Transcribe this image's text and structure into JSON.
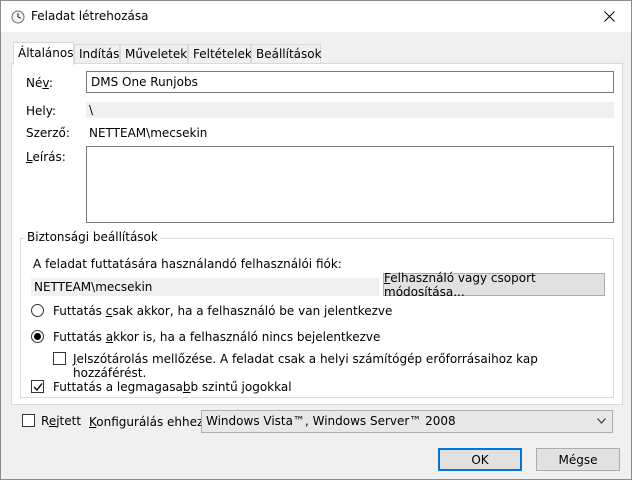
{
  "window": {
    "title": "Feladat létrehozása"
  },
  "tabs": [
    {
      "label": "Általános",
      "active": true
    },
    {
      "label": "Indítás"
    },
    {
      "label": "Műveletek"
    },
    {
      "label": "Feltételek"
    },
    {
      "label": "Beállítások"
    }
  ],
  "general": {
    "name_label": "Név:",
    "name_value": "DMS One Runjobs",
    "location_label": "Hely:",
    "location_value": "\\",
    "author_label": "Szerző:",
    "author_value": "NETTEAM\\mecsekin",
    "description_label": "Leírás:",
    "description_value": ""
  },
  "security": {
    "title": "Biztonsági beállítások",
    "account_label": "A feladat futtatására használandó felhasználói fiók:",
    "account_value": "NETTEAM\\mecsekin",
    "change_button": "Felhasználó vagy csoport módosítása...",
    "radio_logged_on": "Futtatás csak akkor, ha a felhasználó be van jelentkezve",
    "radio_whether": "Futtatás akkor is, ha a felhasználó nincs bejelentkezve",
    "no_password": "Jelszótárolás mellőzése. A feladat csak a helyi számítógép erőforrásaihoz kap hozzáférést.",
    "highest_priv": "Futtatás a legmagasabb szintű jogokkal",
    "radio_selected": "whether",
    "highest_priv_checked": true,
    "no_password_checked": false
  },
  "footer": {
    "hidden_label": "Rejtett",
    "hidden_checked": false,
    "configure_label": "Konfigurálás ehhez:",
    "configure_value": "Windows Vista™, Windows Server™ 2008",
    "ok": "OK",
    "cancel": "Mégse"
  },
  "colors": {
    "accent": "#0078d7"
  }
}
